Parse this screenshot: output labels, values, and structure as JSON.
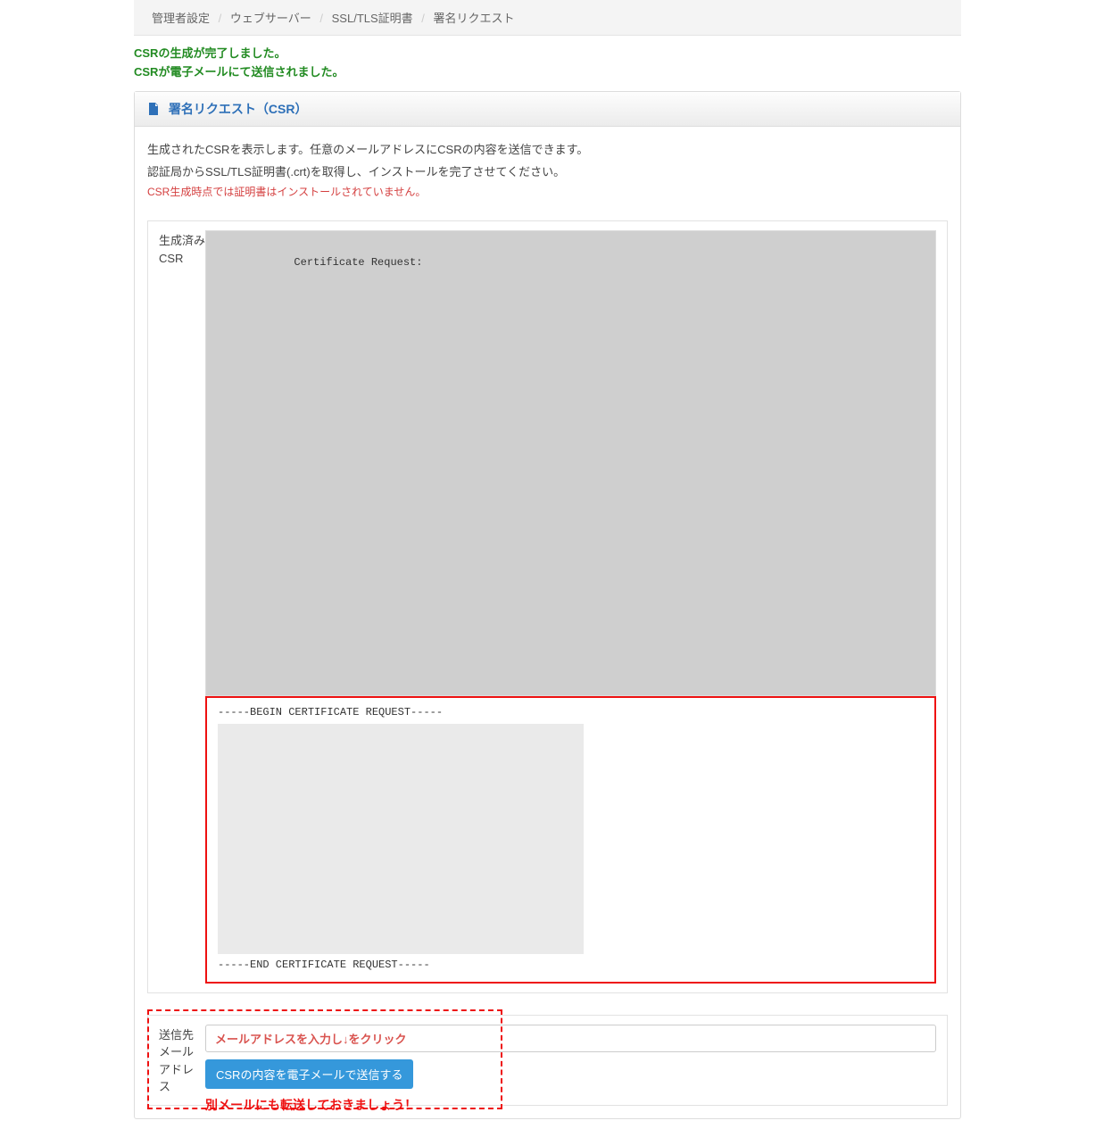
{
  "breadcrumb": {
    "items": [
      "管理者設定",
      "ウェブサーバー",
      "SSL/TLS証明書",
      "署名リクエスト"
    ]
  },
  "alerts": {
    "line1": "CSRの生成が完了しました。",
    "line2": "CSRが電子メールにて送信されました。"
  },
  "panel": {
    "title": "署名リクエスト（CSR）",
    "desc1": "生成されたCSRを表示します。任意のメールアドレスにCSRの内容を送信できます。",
    "desc2": "認証局からSSL/TLS証明書(.crt)を取得し、インストールを完了させてください。",
    "warn": "CSR生成時点では証明書はインストールされていません。"
  },
  "csr": {
    "label": "生成済み\nCSR",
    "header_line": "Certificate Request:",
    "begin_line": "-----BEGIN CERTIFICATE REQUEST-----",
    "end_line": "-----END CERTIFICATE REQUEST-----"
  },
  "email": {
    "label": "送信先\nメール\nアドレ\nス",
    "input_value": "メールアドレスを入力し↓をクリック",
    "button_label": "CSRの内容を電子メールで送信する",
    "annot_bottom": "別メールにも転送しておきましょう！"
  }
}
